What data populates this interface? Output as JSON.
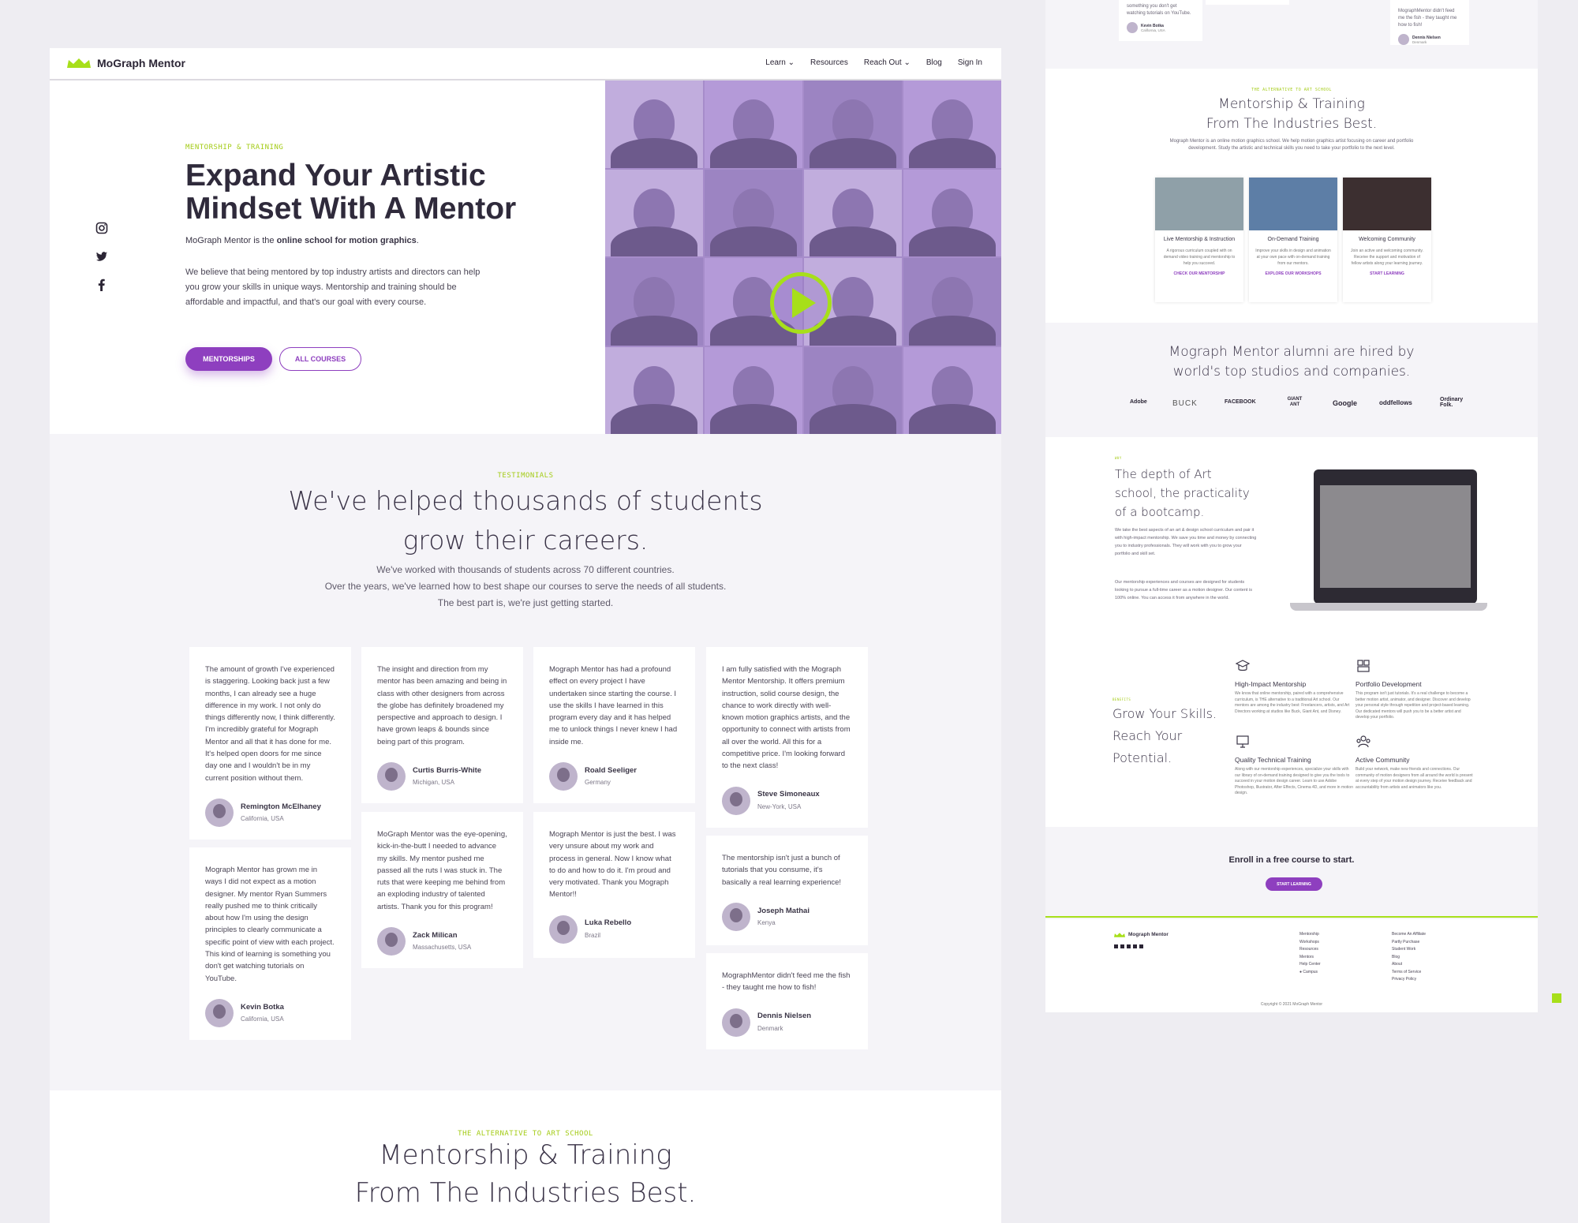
{
  "brand": {
    "name": "MoGraph Mentor",
    "accent": "#8e3fbf",
    "lime": "#a7df1a"
  },
  "nav": {
    "items": [
      "Learn",
      "Resources",
      "Reach Out",
      "Blog",
      "Sign In"
    ]
  },
  "hero": {
    "eyebrow": "MENTORSHIP & TRAINING",
    "title": "Expand Your Artistic Mindset With A Mentor",
    "sub_prefix": "MoGraph Mentor is the ",
    "sub_bold": "online school for motion graphics",
    "sub_suffix": ".",
    "body": "We believe that being mentored by top industry artists and directors can help you grow your skills in unique ways. Mentorship and training should be affordable and impactful, and that's our goal with every course.",
    "btn_primary": "MENTORSHIPS",
    "btn_secondary": "ALL COURSES"
  },
  "social": [
    "instagram-icon",
    "twitter-icon",
    "facebook-icon"
  ],
  "testimonials": {
    "eyebrow": "TESTIMONIALS",
    "title": "We've helped thousands of students grow their careers.",
    "sub1": "We've worked with thousands of students across 70 different countries.",
    "sub2": "Over the years, we've learned how to best shape our courses to serve the needs of all students.",
    "sub3": "The best part is, we're just getting started.",
    "cards": [
      {
        "text": "The amount of growth I've experienced is staggering. Looking back just a few months, I can already see a huge difference in my work. I not only do things differently now, I think differently. I'm incredibly grateful for Mograph Mentor and all that it has done for me. It's helped open doors for me since day one and I wouldn't be in my current position without them.",
        "name": "Remington McElhaney",
        "loc": "California, USA"
      },
      {
        "text": "Mograph Mentor has grown me in ways I did not expect as a motion designer. My mentor Ryan Summers really pushed me to think critically about how I'm using the design principles to clearly communicate a specific point of view with each project. This kind of learning is something you don't get watching tutorials on YouTube.",
        "name": "Kevin Botka",
        "loc": "California, USA"
      },
      {
        "text": "The insight and direction from my mentor has been amazing and being in class with other designers from across the globe has definitely broadened my perspective and approach to design. I have grown leaps & bounds since being part of this program.",
        "name": "Curtis Burris-White",
        "loc": "Michigan, USA"
      },
      {
        "text": "MoGraph Mentor was the eye-opening, kick-in-the-butt I needed to advance my skills. My mentor pushed me passed all the ruts I was stuck in. The ruts that were keeping me behind from an exploding industry of talented artists. Thank you for this program!",
        "name": "Zack Milican",
        "loc": "Massachusetts, USA"
      },
      {
        "text": "Mograph Mentor has had a profound effect on every project I have undertaken since starting the course. I use the skills I have learned in this program every day and it has helped me to unlock things I never knew I had inside me.",
        "name": "Roald Seeliger",
        "loc": "Germany"
      },
      {
        "text": "Mograph Mentor is just the best. I was very unsure about my work and process in general. Now I know what to do and how to do it. I'm proud and very motivated. Thank you Mograph Mentor!!",
        "name": "Luka Rebello",
        "loc": "Brazil"
      },
      {
        "text": "I am fully satisfied with the Mograph Mentor Mentorship. It offers premium instruction, solid course design, the chance to work directly with well-known motion graphics artists, and the opportunity to connect with artists from all over the world. All this for a competitive price. I'm looking forward to the next class!",
        "name": "Steve Simoneaux",
        "loc": "New-York, USA"
      },
      {
        "text": "The mentorship isn't just a bunch of tutorials that you consume, it's basically a real learning experience!",
        "name": "Joseph Mathai",
        "loc": "Kenya"
      },
      {
        "text": "MographMentor didn't feed me the fish - they taught me how to fish!",
        "name": "Dennis Nielsen",
        "loc": "Denmark"
      }
    ]
  },
  "alt_section": {
    "eyebrow": "THE ALTERNATIVE TO ART SCHOOL",
    "title_line1": "Mentorship & Training",
    "title_line2": "From The Industries Best.",
    "body": "Mograph Mentor is an online motion graphics school. We help motion graphics artist focusing on career and portfolio development. Study the artistic and technical skills you need to take your portfolio to the next level.",
    "features": [
      {
        "title": "Live Mentorship & Instruction",
        "desc": "A rigorous curriculum coupled with on demand video training and mentorship to help you succeed.",
        "link": "CHECK OUR MENTORSHIP"
      },
      {
        "title": "On-Demand Training",
        "desc": "Improve your skills in design and animation at your own pace with on-demand training from our mentors.",
        "link": "EXPLORE OUR WORKSHOPS"
      },
      {
        "title": "Welcoming Community",
        "desc": "Join an active and welcoming community. Receive the support and motivation of fellow artists along your learning journey.",
        "link": "START LEARNING"
      }
    ]
  },
  "alumni": {
    "title_line1": "Mograph Mentor alumni are hired by",
    "title_line2": "world's top studios and companies.",
    "logos": [
      "Adobe",
      "BUCK",
      "FACEBOOK",
      "GIANT ANT",
      "Google",
      "oddfellows",
      "Ordinary Folk."
    ]
  },
  "depth": {
    "eyebrow": "WHY",
    "title_line1": "The depth of Art",
    "title_line2": "school, the practicality",
    "title_line3": "of a bootcamp.",
    "body1": "We take the best aspects of an art & design school curriculum and pair it with high-impact mentorship. We save you time and money by connecting you to industry professionals. They will work with you to grow your portfolio and skill set.",
    "body2": "Our mentorship experiences and courses are designed for students looking to pursue a full-time career as a motion designer. Our content is 100% online. You can access it from anywhere in the world."
  },
  "skills": {
    "eyebrow": "BENEFITS",
    "title_line1": "Grow Your Skills.",
    "title_line2": "Reach Your",
    "title_line3": "Potential.",
    "items": [
      {
        "title": "High-Impact Mentorship",
        "desc": "We know that online mentorship, paired with a comprehensive curriculum, is THE alternative to a traditional Art school. Our mentors are among the industry best: Freelancers, artists, and Art Directors working at studios like Buck, Giant Ant, and Disney."
      },
      {
        "title": "Portfolio Development",
        "desc": "This program isn't just tutorials. It's a real challenge to become a better motion artist, animator, and designer. Discover and develop your personal style through repetition and project-based learning. Our dedicated mentors will push you to be a better artist and develop your portfolio."
      },
      {
        "title": "Quality Technical Training",
        "desc": "Along with our mentorship experiences, specialize your skills with our library of on-demand training designed to give you the tools to succeed in your motion design career. Learn to use Adobe Photoshop, Illustrator, After Effects, Cinema 4D, and more in motion design."
      },
      {
        "title": "Active Community",
        "desc": "Build your network, make new friends and connections. Our community of motion designers from all around the world is present at every step of your motion design journey. Receive feedback and accountability from artists and animators like you."
      }
    ]
  },
  "enroll": {
    "title": "Enroll in a free course to start.",
    "button": "START LEARNING"
  },
  "footer": {
    "brand": "Mograph Mentor",
    "col1": [
      "Mentorship",
      "Workshops",
      "Resources",
      "Mentors",
      "Help Center",
      "Campus"
    ],
    "col2": [
      "Become An Affiliate",
      "Partly Purchase",
      "Student Work",
      "Blog",
      "About",
      "Terms of Service",
      "Privacy Policy"
    ],
    "copyright": "Copyright © 2021 MoGraph Mentor"
  },
  "top_strip": {
    "card1_text": "something you don't get watching tutorials on YouTube.",
    "card1_name": "Kevin Botka",
    "card1_loc": "California, USA",
    "card2_text": "MographMentor didn't feed me the fish - they taught me how to fish!",
    "card2_name": "Dennis Nielsen",
    "card2_loc": "Denmark"
  }
}
